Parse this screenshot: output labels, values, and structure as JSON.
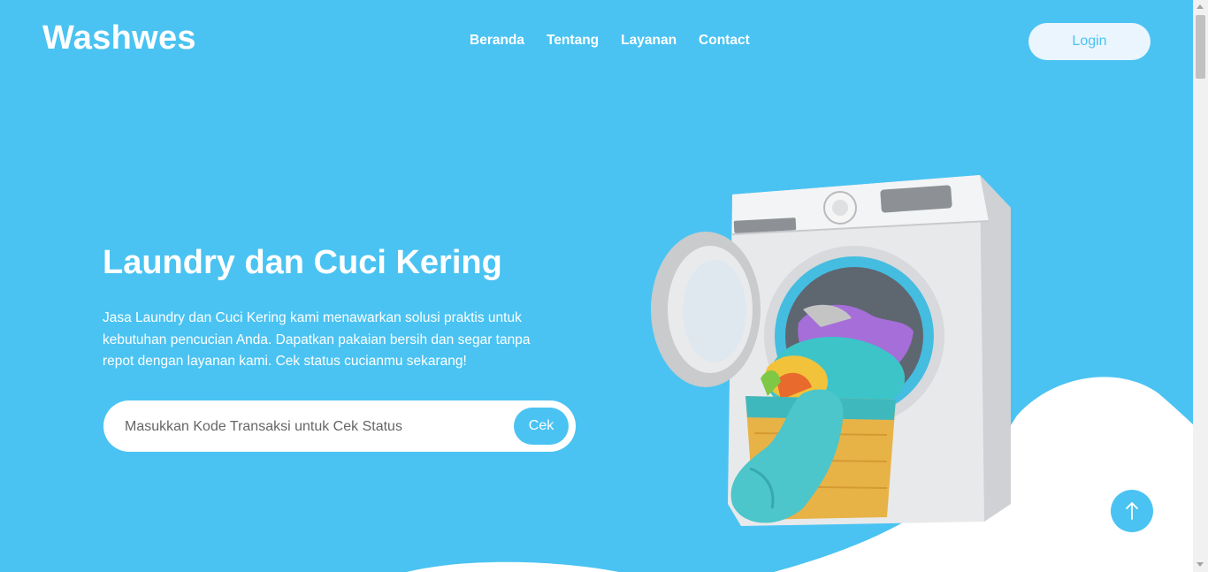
{
  "header": {
    "brand": "Washwes",
    "nav": [
      "Beranda",
      "Tentang",
      "Layanan",
      "Contact"
    ],
    "login_label": "Login"
  },
  "hero": {
    "title": "Laundry dan Cuci Kering",
    "description": "Jasa Laundry dan Cuci Kering kami menawarkan solusi praktis untuk kebutuhan pencucian Anda. Dapatkan pakaian bersih dan segar tanpa repot dengan layanan kami. Cek status cucianmu sekarang!",
    "search": {
      "placeholder": "Masukkan Kode Transaksi untuk Cek Status",
      "value": "",
      "button_label": "Cek"
    },
    "image_icon": "washing-machine-with-laundry-basket"
  },
  "scroll_top_icon": "arrow-up-icon",
  "colors": {
    "primary": "#4ac3f2",
    "white": "#ffffff",
    "login_bg": "#eaf5fd"
  }
}
